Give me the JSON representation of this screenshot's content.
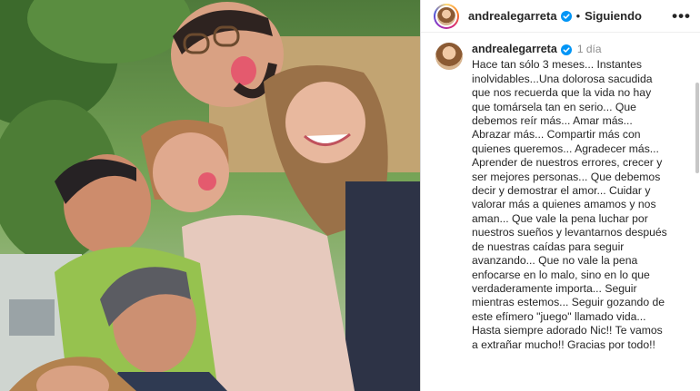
{
  "post": {
    "username": "andrealegarreta",
    "follow_status": "Siguiendo",
    "separator": "•",
    "more_label": "•••",
    "time": "1 día",
    "caption": "Hace tan sólo 3 meses... Instantes\ninolvidables...Una dolorosa sacudida\nque nos recuerda que la vida no hay\nque tomársela tan en serio... Que\ndebemos reír más... Amar más...\nAbrazar más... Compartir más con\nquienes queremos... Agradecer más...\nAprender de nuestros errores, crecer y\nser mejores personas... Que debemos\ndecir y demostrar el amor... Cuidar y\nvalorar más a quienes amamos y nos\naman... Que vale la pena luchar por\nnuestros sueños y levantarnos después\nde nuestras caídas para seguir\navanzando... Que no vale la pena\nenfocarse en lo malo, sino en lo que\nverdaderamente importa... Seguir\nmientras estemos... Seguir gozando de\neste efímero \"juego\" llamado vida...\nHasta siempre adorado Nic!! Te vamos\na extrañar mucho!! Gracias por todo!!"
  },
  "icons": {
    "verified": "verified-badge-icon",
    "more": "more-options-icon"
  },
  "colors": {
    "verified": "#0095f6",
    "text": "#262626",
    "muted": "#8e8e8e"
  }
}
